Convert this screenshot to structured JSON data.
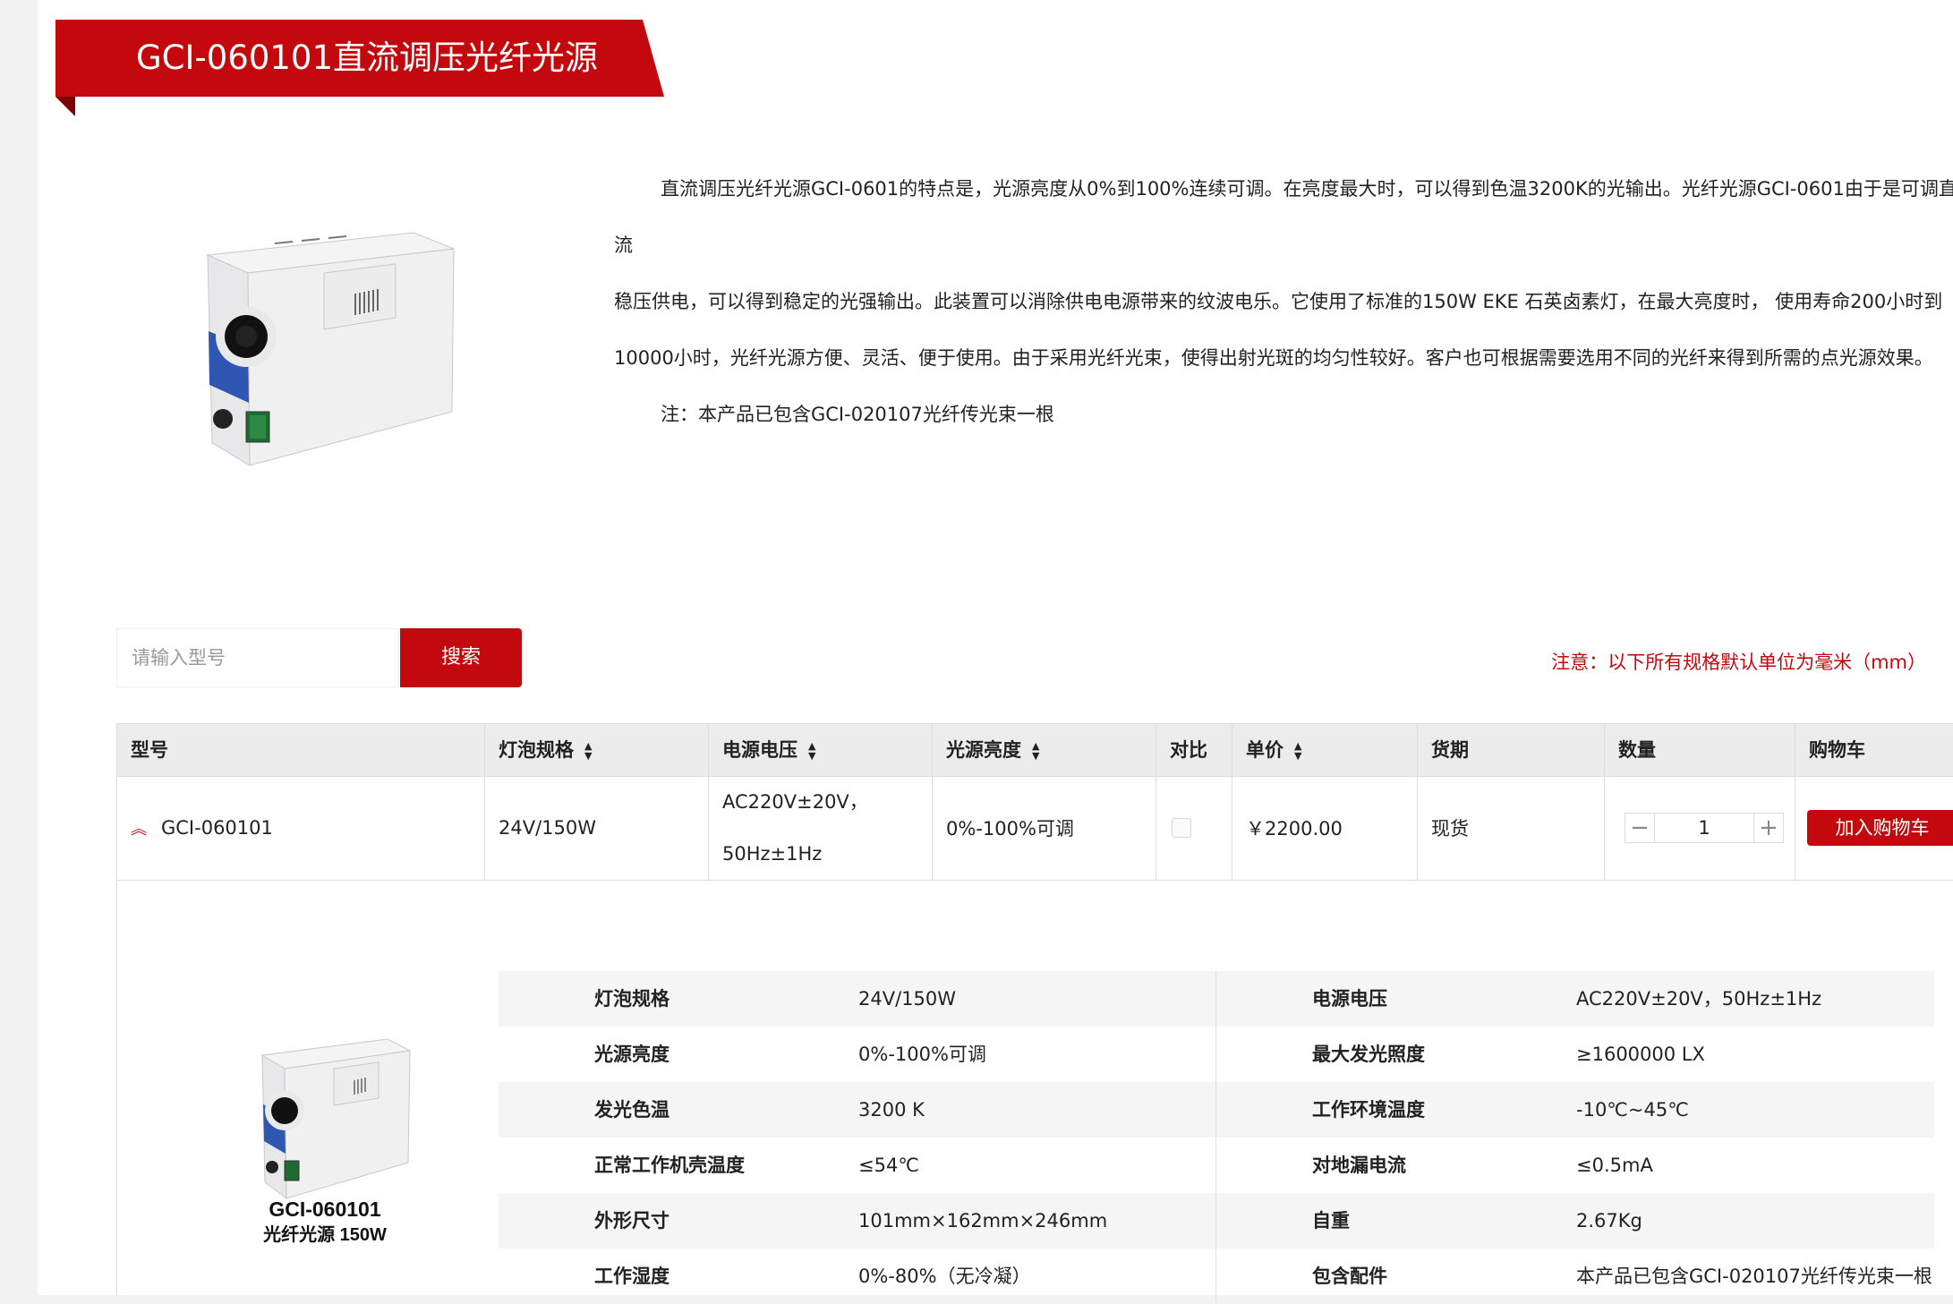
{
  "page": {
    "title": "GCI-060101直流调压光纤光源",
    "description": [
      "直流调压光纤光源GCI-0601的特点是，光源亮度从0%到100%连续可调。在亮度最大时，可以得到色温3200K的光输出。光纤光源GCI-0601由于是可调直流",
      "稳压供电，可以得到稳定的光强输出。此装置可以消除供电电源带来的纹波电乐。它使用了标准的150W EKE 石英卤素灯，在最大亮度时，  使用寿命200小时到",
      "10000小时，光纤光源方便、灵活、便于使用。由于采用光纤光束，使得出射光斑的均匀性较好。客户也可根据需要选用不同的光纤来得到所需的点光源效果。",
      "注：本产品已包含GCI-020107光纤传光束一根"
    ]
  },
  "search": {
    "placeholder": "请输入型号",
    "button_label": "搜索"
  },
  "notice": "注意：以下所有规格默认单位为毫米（mm）",
  "table": {
    "headers": {
      "model": "型号",
      "bulb": "灯泡规格",
      "voltage": "电源电压",
      "brightness": "光源亮度",
      "compare": "对比",
      "price": "单价",
      "delivery": "货期",
      "quantity": "数量",
      "cart": "购物车"
    },
    "row": {
      "model": "GCI-060101",
      "bulb": "24V/150W",
      "voltage_line1": "AC220V±20V，",
      "voltage_line2": "50Hz±1Hz",
      "brightness": "0%-100%可调",
      "price": "￥2200.00",
      "delivery": "现货",
      "quantity": "1",
      "minus": "−",
      "plus": "+",
      "add_to_cart": "加入购物车"
    }
  },
  "detail": {
    "caption_model": "GCI-060101",
    "caption_desc": "光纤光源   150W",
    "specs": [
      {
        "l1": "灯泡规格",
        "v1": "24V/150W",
        "l2": "电源电压",
        "v2": "AC220V±20V，50Hz±1Hz"
      },
      {
        "l1": "光源亮度",
        "v1": "0%-100%可调",
        "l2": "最大发光照度",
        "v2": "≥1600000 LX"
      },
      {
        "l1": "发光色温",
        "v1": "3200 K",
        "l2": "工作环境温度",
        "v2": "-10℃~45℃"
      },
      {
        "l1": "正常工作机壳温度",
        "v1": "≤54℃",
        "l2": "对地漏电流",
        "v2": "≤0.5mA"
      },
      {
        "l1": "外形尺寸",
        "v1": "101mm×162mm×246mm",
        "l2": "自重",
        "v2": "2.67Kg"
      },
      {
        "l1": "工作湿度",
        "v1": "0%-80%（无冷凝）",
        "l2": "包含配件",
        "v2": "本产品已包含GCI-020107光纤传光束一根"
      }
    ]
  },
  "colors": {
    "accent": "#c4090e",
    "header_bg": "#ececec",
    "row_shade": "#f5f5f5"
  },
  "icons": {
    "sort": "sort-up-down-icon",
    "expand": "double-chevron-up-icon"
  }
}
